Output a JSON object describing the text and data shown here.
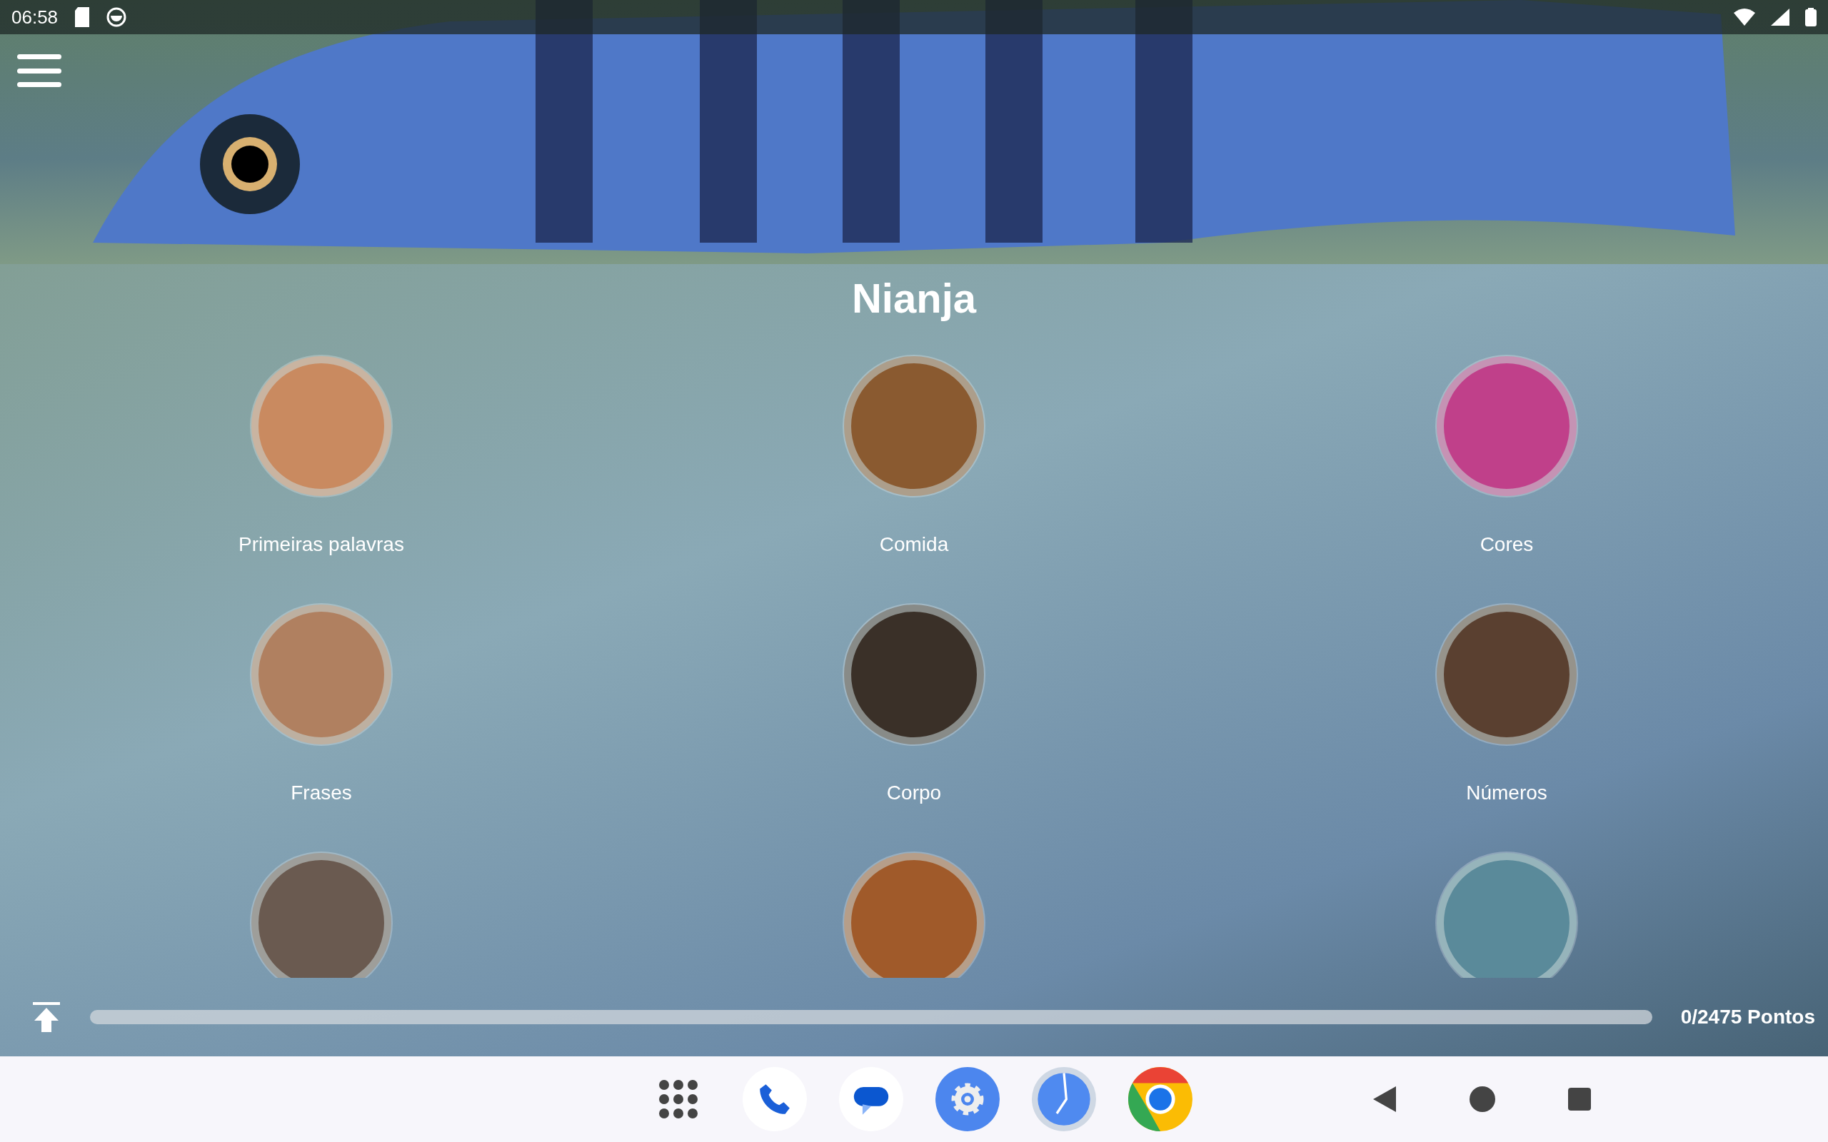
{
  "status_bar": {
    "time": "06:58"
  },
  "header": {
    "title": "Nianja"
  },
  "categories": [
    {
      "kind": "labeled",
      "label": "Primeiras palavras"
    },
    {
      "kind": "labeled",
      "label": "Comida"
    },
    {
      "kind": "labeled",
      "label": "Cores"
    },
    {
      "kind": "labeled",
      "label": "Frases"
    },
    {
      "kind": "labeled",
      "label": "Corpo"
    },
    {
      "kind": "labeled",
      "label": "Números"
    },
    {
      "kind": "cut"
    },
    {
      "kind": "cut"
    },
    {
      "kind": "cut"
    }
  ],
  "progress": {
    "level": 0,
    "reading": "0/2475 Pontos"
  }
}
